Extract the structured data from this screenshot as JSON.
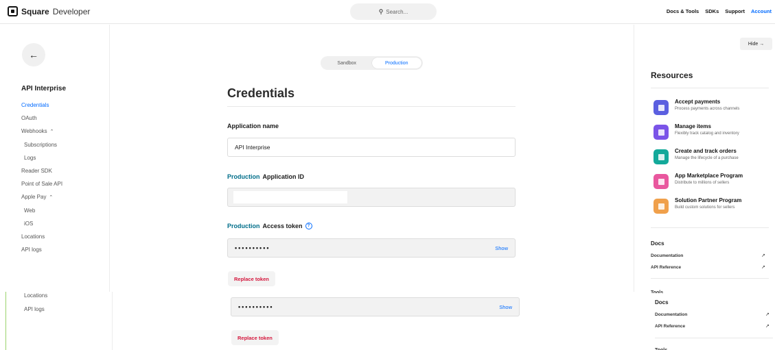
{
  "topbar": {
    "brand_bold": "Square",
    "brand_sub": "Developer",
    "search_placeholder": "Search...",
    "nav": [
      "Docs & Tools",
      "SDKs",
      "Support",
      "Account"
    ]
  },
  "sidebar": {
    "back_icon": "arrow-left-icon",
    "app_name": "API Interprise",
    "items": [
      {
        "label": "Credentials"
      },
      {
        "label": "OAuth"
      },
      {
        "label": "Webhooks"
      },
      {
        "label": "Subscriptions"
      },
      {
        "label": "Logs"
      },
      {
        "label": "Reader SDK"
      },
      {
        "label": "Point of Sale API"
      },
      {
        "label": "Apple Pay"
      },
      {
        "label": "Web"
      },
      {
        "label": "iOS"
      },
      {
        "label": "Locations"
      },
      {
        "label": "API logs"
      }
    ],
    "lower_items": [
      {
        "label": "Locations"
      },
      {
        "label": "API logs"
      }
    ]
  },
  "main": {
    "env_options": [
      "Sandbox",
      "Production"
    ],
    "env_selected": "Production",
    "title": "Credentials",
    "app_name_label": "Application name",
    "app_name_value": "API Interprise",
    "env_word": "Production",
    "app_id_label": "Application ID",
    "token_label": "Access token",
    "token_value": "••••••••••",
    "show_label": "Show",
    "replace_label": "Replace token"
  },
  "resources": {
    "hide_label": "Hide →",
    "title": "Resources",
    "items": [
      {
        "name": "Accept payments",
        "desc": "Process payments across channels",
        "color": "#5b5fe0",
        "icon": "card-icon"
      },
      {
        "name": "Manage items",
        "desc": "Flexibly track catalog and inventory",
        "color": "#7b54e8",
        "icon": "catalog-icon"
      },
      {
        "name": "Create and track orders",
        "desc": "Manage the lifecycle of a purchase",
        "color": "#13a99a",
        "icon": "orders-icon"
      },
      {
        "name": "App Marketplace Program",
        "desc": "Distribute to millions of sellers",
        "color": "#e9579e",
        "icon": "marketplace-icon"
      },
      {
        "name": "Solution Partner Program",
        "desc": "Build custom solutions for sellers",
        "color": "#f0a04b",
        "icon": "partner-icon"
      }
    ],
    "docs_title": "Docs",
    "docs_links": [
      "Documentation",
      "API Reference"
    ],
    "tools_peek": "Tools"
  }
}
